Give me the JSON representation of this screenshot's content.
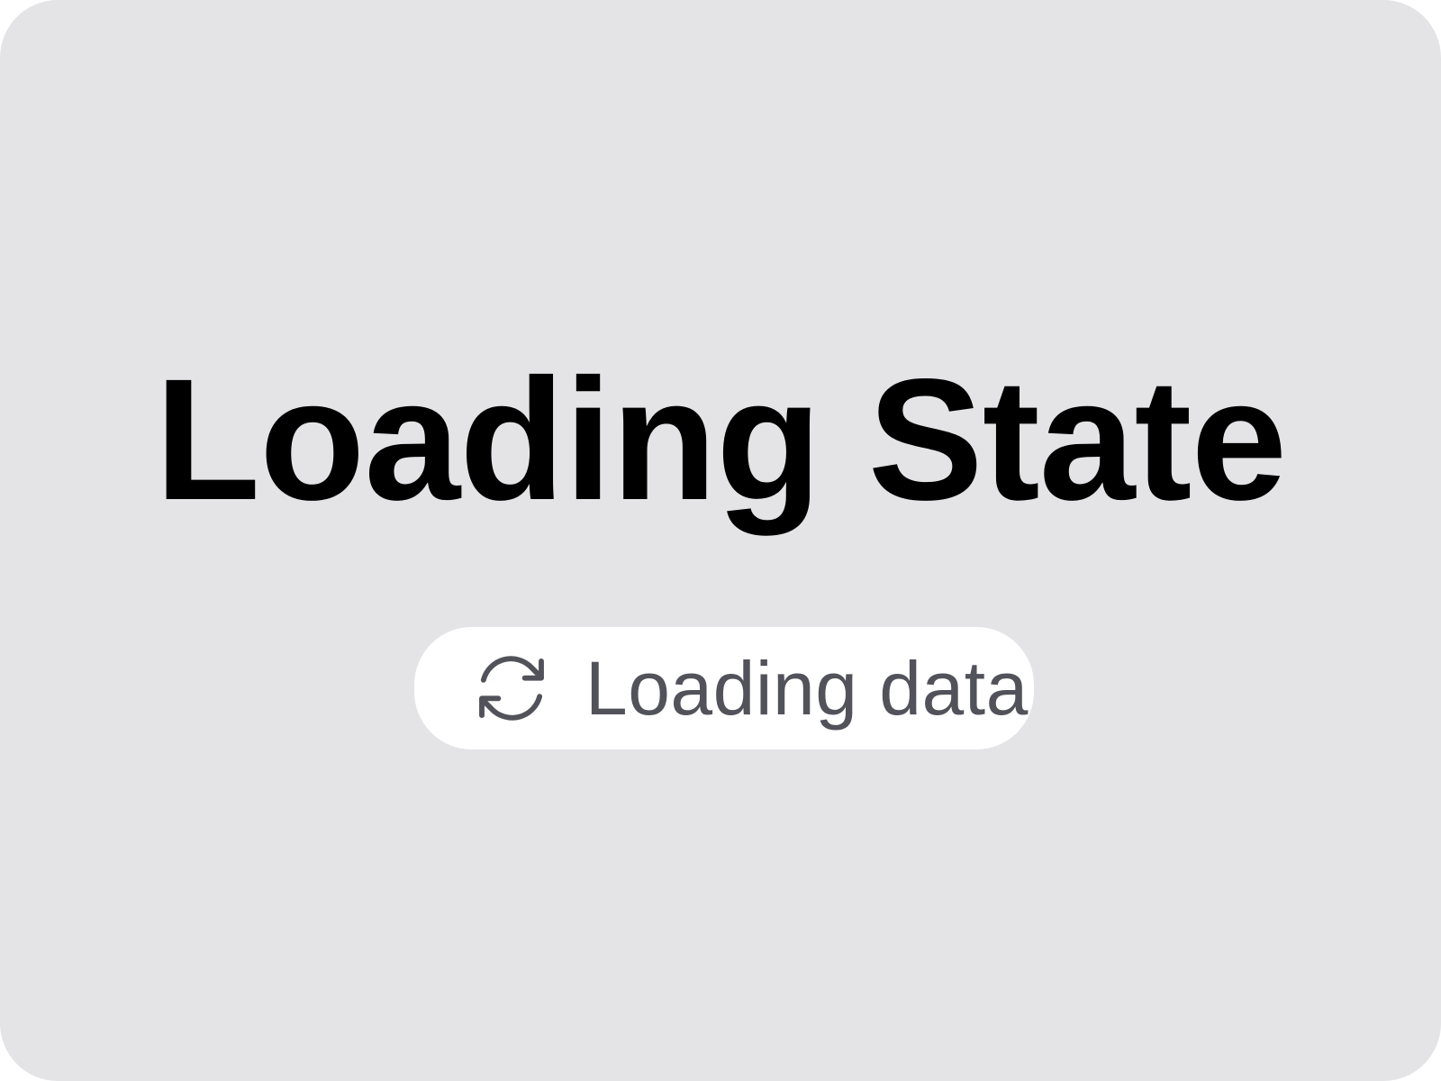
{
  "title": "Loading State",
  "status": {
    "label": "Loading data",
    "icon": "refresh-icon"
  },
  "colors": {
    "background": "#e4e4e7",
    "pill": "#ffffff",
    "title": "#000000",
    "status_text": "#52525b"
  }
}
